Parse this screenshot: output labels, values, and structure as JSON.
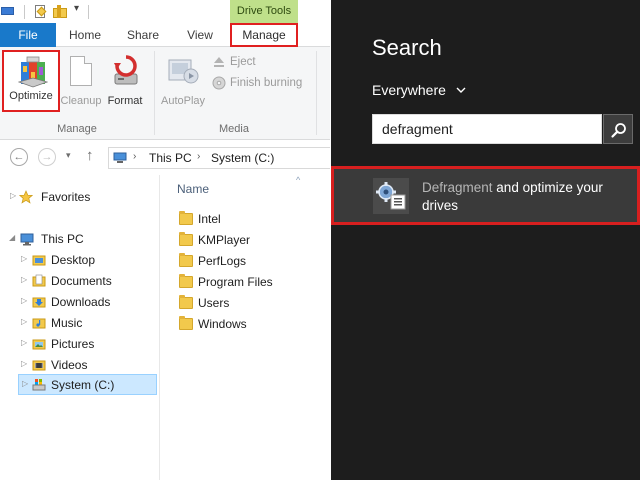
{
  "explorer": {
    "quick_access": {
      "dropdown_glyph": "▾"
    },
    "contextual_tab_header": "Drive Tools",
    "ribbon_tabs": [
      {
        "label": "File"
      },
      {
        "label": "Home"
      },
      {
        "label": "Share"
      },
      {
        "label": "View"
      },
      {
        "label": "Manage"
      }
    ],
    "ribbon": {
      "manage_group": {
        "label": "Manage",
        "buttons": [
          {
            "label": "Optimize",
            "icon": "optimize-icon"
          },
          {
            "label": "Cleanup",
            "icon": "cleanup-icon",
            "disabled": true
          },
          {
            "label": "Format",
            "icon": "format-icon"
          }
        ]
      },
      "media_group": {
        "label": "Media",
        "buttons": [
          {
            "label": "AutoPlay",
            "icon": "autoplay-icon",
            "disabled": true
          },
          {
            "label": "Eject",
            "icon": "eject-icon",
            "disabled": true
          },
          {
            "label": "Finish burning",
            "icon": "burn-icon",
            "disabled": true
          }
        ]
      }
    },
    "address_bar": {
      "back_glyph": "←",
      "forward_glyph": "→",
      "recent_glyph": "▾",
      "up_glyph": "↑",
      "separator_glyph": "›",
      "path": [
        "This PC",
        "System (C:)"
      ]
    },
    "nav_tree": {
      "favorites": "Favorites",
      "this_pc": "This PC",
      "collapsed_glyph": "▷",
      "expanded_glyph": "◢",
      "children": [
        "Desktop",
        "Documents",
        "Downloads",
        "Music",
        "Pictures",
        "Videos",
        "System (C:)"
      ]
    },
    "file_list": {
      "column_header": "Name",
      "sort_glyph": "^",
      "items": [
        "Intel",
        "KMPlayer",
        "PerfLogs",
        "Program Files",
        "Users",
        "Windows"
      ]
    }
  },
  "search_charm": {
    "title": "Search",
    "scope": "Everywhere",
    "query": "defragment",
    "result": {
      "highlight": "Defragment",
      "text": " and optimize your drives"
    }
  },
  "colors": {
    "file_tab": "#1979ca",
    "drive_tools": "#bfe08a",
    "highlight_border": "#e02020",
    "charm_background": "#1d1d1d",
    "result_background": "#3a3a3a",
    "selection": "#cce8ff"
  }
}
